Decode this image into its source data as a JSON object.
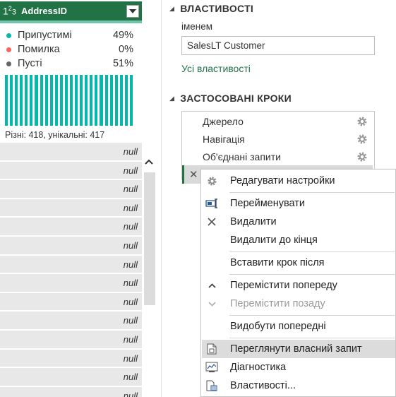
{
  "column": {
    "type_icon_main": "1",
    "type_icon_sup": "2",
    "type_icon_sub": "3",
    "name": "AddressID",
    "filter_icon": "dropdown-icon"
  },
  "quality": [
    {
      "label": "Припустимі",
      "value": "49%",
      "color": "#01b8aa"
    },
    {
      "label": "Помилка",
      "value": "0%",
      "color": "#fd625e"
    },
    {
      "label": "Пусті",
      "value": "51%",
      "color": "#666666"
    }
  ],
  "distribution": {
    "bar_count": 26,
    "summary": "Різні: 418, унікальні: 417",
    "color": "#01b8aa"
  },
  "rows": [
    "null",
    "null",
    "null",
    "null",
    "null",
    "null",
    "null",
    "null",
    "null",
    "null",
    "null",
    "null",
    "null",
    "null"
  ],
  "properties": {
    "title": "ВЛАСТИВОСТІ",
    "name_label": "іменем",
    "name_value": "SalesLT Customer",
    "all_properties": "Усі властивості"
  },
  "applied_steps": {
    "title": "ЗАСТОСОВАНІ КРОКИ",
    "steps": [
      "Джерело",
      "Навігація",
      "Об'єднані запити"
    ]
  },
  "context_menu": {
    "items": [
      {
        "label": "Редагувати настройки",
        "icon": "gear-icon"
      },
      {
        "label": "Перейменувати",
        "icon": "rename-icon"
      },
      {
        "label": "Видалити",
        "icon": "close-icon"
      },
      {
        "label": "Видалити до кінця",
        "icon": ""
      },
      {
        "label": "Вставити крок після",
        "icon": ""
      },
      {
        "label": "Перемістити попереду",
        "icon": "chevron-up-icon"
      },
      {
        "label": "Перемістити позаду",
        "icon": "chevron-down-icon",
        "disabled": true
      },
      {
        "label": "Видобути попередні",
        "icon": ""
      },
      {
        "label": "Переглянути власний запит",
        "icon": "native-query-icon",
        "highlighted": true
      },
      {
        "label": "Діагностика",
        "icon": "diagnostics-icon"
      },
      {
        "label": "Властивості...",
        "icon": "properties-icon"
      }
    ]
  },
  "colors": {
    "accent": "#217346",
    "valid": "#01b8aa",
    "error": "#fd625e",
    "empty": "#666666"
  }
}
